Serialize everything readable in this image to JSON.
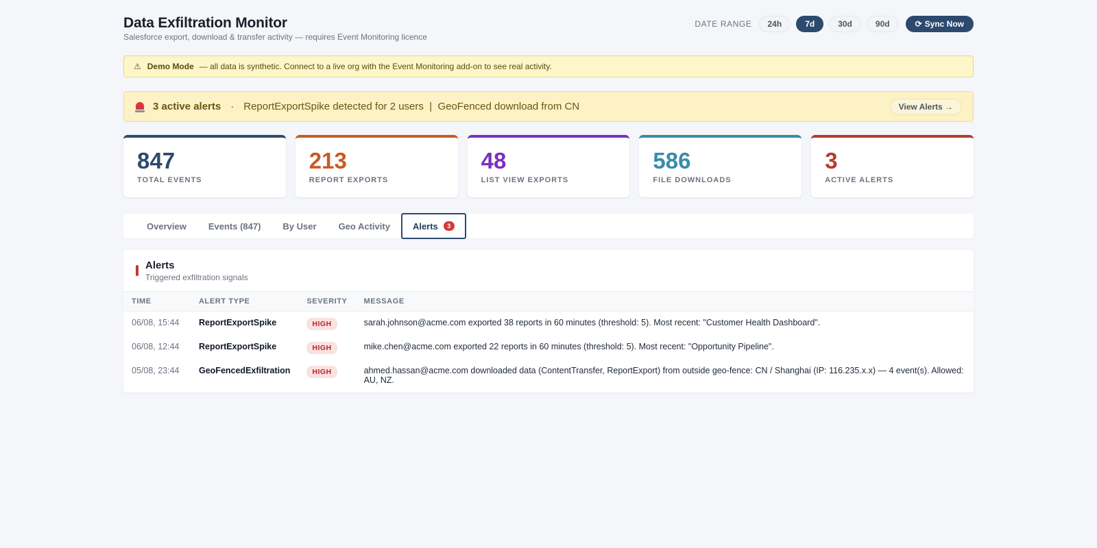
{
  "header": {
    "title": "Data Exfiltration Monitor",
    "subtitle": "Salesforce export, download & transfer activity — requires Event Monitoring licence",
    "date_range_label": "DATE RANGE",
    "ranges": [
      "24h",
      "7d",
      "30d",
      "90d"
    ],
    "active_range": "7d",
    "sync_icon": "refresh-icon",
    "sync_glyph": "⟳",
    "sync_label": "Sync Now"
  },
  "demo_banner": {
    "icon": "warning-icon",
    "glyph": "⚠",
    "strong": "Demo Mode",
    "text": "— all data is synthetic. Connect to a live org with the Event Monitoring add-on to see real activity."
  },
  "alerts_banner": {
    "icon": "siren-icon",
    "count_text": "3 active alerts",
    "separator": "·",
    "summary": "ReportExportSpike detected for 2 users  |  GeoFenced download from CN",
    "view_button": "View Alerts →"
  },
  "stats": [
    {
      "value": "847",
      "label": "TOTAL EVENTS",
      "color": "#2c4a6e"
    },
    {
      "value": "213",
      "label": "REPORT EXPORTS",
      "color": "#c85a24"
    },
    {
      "value": "48",
      "label": "LIST VIEW EXPORTS",
      "color": "#7b2fbf"
    },
    {
      "value": "586",
      "label": "FILE DOWNLOADS",
      "color": "#3a8bab"
    },
    {
      "value": "3",
      "label": "ACTIVE ALERTS",
      "color": "#b83a2b"
    }
  ],
  "tabs": [
    {
      "label": "Overview"
    },
    {
      "label": "Events (847)"
    },
    {
      "label": "By User"
    },
    {
      "label": "Geo Activity"
    },
    {
      "label": "Alerts",
      "badge": "3"
    }
  ],
  "active_tab": "Alerts",
  "alerts_panel": {
    "title": "Alerts",
    "subtitle": "Triggered exfiltration signals",
    "columns": [
      "TIME",
      "ALERT TYPE",
      "SEVERITY",
      "MESSAGE"
    ],
    "rows": [
      {
        "time": "06/08, 15:44",
        "type": "ReportExportSpike",
        "severity": "HIGH",
        "message": "sarah.johnson@acme.com exported 38 reports in 60 minutes (threshold: 5). Most recent: \"Customer Health Dashboard\"."
      },
      {
        "time": "06/08, 12:44",
        "type": "ReportExportSpike",
        "severity": "HIGH",
        "message": "mike.chen@acme.com exported 22 reports in 60 minutes (threshold: 5). Most recent: \"Opportunity Pipeline\"."
      },
      {
        "time": "05/08, 23:44",
        "type": "GeoFencedExfiltration",
        "severity": "HIGH",
        "message": "ahmed.hassan@acme.com downloaded data (ContentTransfer, ReportExport) from outside geo-fence: CN / Shanghai (IP: 116.235.x.x) — 4 event(s). Allowed: AU, NZ."
      }
    ]
  }
}
